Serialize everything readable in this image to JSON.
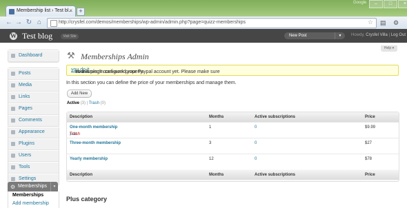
{
  "browser": {
    "tab_title": "Membership list › Test bl...",
    "tab_close": "×",
    "new_tab": "+",
    "corner_user": "Google",
    "url": "http://crysfel.com/demos/memberships/wp-admin/admin.php?page=quizz-memberships",
    "nav": {
      "back": "←",
      "forward": "→",
      "reload": "↻",
      "home": "⌂"
    },
    "window_buttons": [
      "–",
      "□",
      "×"
    ],
    "star": "☆",
    "page_menu": "▤",
    "tools_menu": "⚙"
  },
  "wp_header": {
    "logo": "W",
    "blog_name": "Test blog",
    "visit_site": "Visit Site",
    "favorite_action": "New Post",
    "howdy_prefix": "Howdy,",
    "user_name": "Crysfel Villa",
    "separator": "|",
    "logout": "Log Out"
  },
  "sidebar": {
    "group1": [
      {
        "label": "Dashboard"
      }
    ],
    "group2": [
      {
        "label": "Posts"
      },
      {
        "label": "Media"
      },
      {
        "label": "Links"
      },
      {
        "label": "Pages"
      },
      {
        "label": "Comments"
      }
    ],
    "group3": [
      {
        "label": "Appearance"
      },
      {
        "label": "Plugins"
      },
      {
        "label": "Users"
      },
      {
        "label": "Tools"
      },
      {
        "label": "Settings"
      }
    ],
    "memberships": {
      "label": "Memberships",
      "submenu": [
        {
          "label": "Memberships"
        },
        {
          "label": "Add membership"
        }
      ]
    }
  },
  "main": {
    "help": "Help ▾",
    "title": "Memberships Admin",
    "notice": {
      "before": "Your haven't configured your Paypal account yet. Please make sure ",
      "link": "you do it",
      "after": " so this plugin can work properly."
    },
    "intro": "In this section you can define the price of your memberships and manage them.",
    "add_new": "Add New",
    "views": {
      "active_label": "Active",
      "active_count": "(3)",
      "separator": "|",
      "trash_label": "Trash",
      "trash_count": "(0)"
    },
    "table": {
      "columns": [
        "Description",
        "Months",
        "Active subscriptions",
        "Price"
      ],
      "rows": [
        {
          "name": "One-month membership",
          "months": "1",
          "subs": "0",
          "price": "$9.99",
          "edit": "Edit",
          "sep": "|",
          "trash": "Trash"
        },
        {
          "name": "Three-month membership",
          "months": "3",
          "subs": "0",
          "price": "$27"
        },
        {
          "name": "Yearly membership",
          "months": "12",
          "subs": "0",
          "price": "$78"
        }
      ]
    },
    "category_title": "Plus category"
  }
}
